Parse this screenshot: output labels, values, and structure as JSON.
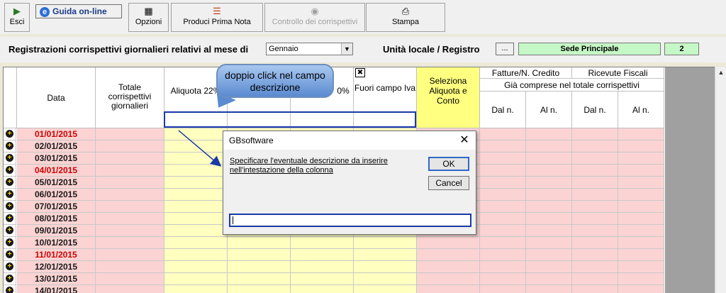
{
  "toolbar": {
    "esci": "Esci",
    "guida": "Guida on-line",
    "opzioni": "Opzioni",
    "prima_nota": "Produci Prima Nota",
    "controllo": "Controllo dei corrispettivi",
    "stampa": "Stampa"
  },
  "header": {
    "label": "Registrazioni corrispettivi giornalieri relativi al mese di",
    "month": "Gennaio",
    "unita_label": "Unità locale / Registro",
    "dots": "...",
    "sede": "Sede Principale",
    "registro": "2"
  },
  "columns": {
    "data": "Data",
    "totale": "Totale corrispettivi giornalieri",
    "aliquota22": "Aliquota 22%",
    "aliquota_partial": "0%",
    "fuori_campo": "Fuori campo Iva",
    "seleziona": "Seleziona Aliquota e Conto",
    "fatture": "Fatture/N. Credito",
    "ricevute": "Ricevute Fiscali",
    "gia_comprese": "Già comprese nel totale corrispettivi",
    "dal_n": "Dal n.",
    "al_n": "Al n."
  },
  "rows": [
    {
      "date": "01/01/2015",
      "red": true
    },
    {
      "date": "02/01/2015",
      "red": false
    },
    {
      "date": "03/01/2015",
      "red": false
    },
    {
      "date": "04/01/2015",
      "red": true
    },
    {
      "date": "05/01/2015",
      "red": false
    },
    {
      "date": "06/01/2015",
      "red": false
    },
    {
      "date": "07/01/2015",
      "red": false
    },
    {
      "date": "08/01/2015",
      "red": false
    },
    {
      "date": "09/01/2015",
      "red": false
    },
    {
      "date": "10/01/2015",
      "red": false
    },
    {
      "date": "11/01/2015",
      "red": true
    },
    {
      "date": "12/01/2015",
      "red": false
    },
    {
      "date": "13/01/2015",
      "red": false
    },
    {
      "date": "14/01/2015",
      "red": false
    }
  ],
  "callout": "doppio click nel campo descrizione",
  "dialog": {
    "title": "GBsoftware",
    "message": "Specificare l'eventuale descrizione da inserire nell'intestazione della colonna",
    "ok": "OK",
    "cancel": "Cancel",
    "input_value": ""
  },
  "colors": {
    "pink": "#fbd3d3",
    "yellow": "#ffffc0",
    "seleziona_bg": "#ffff80",
    "green": "#c6f7c6",
    "red_date": "#d00000",
    "highlight": "#1a3aa8"
  }
}
